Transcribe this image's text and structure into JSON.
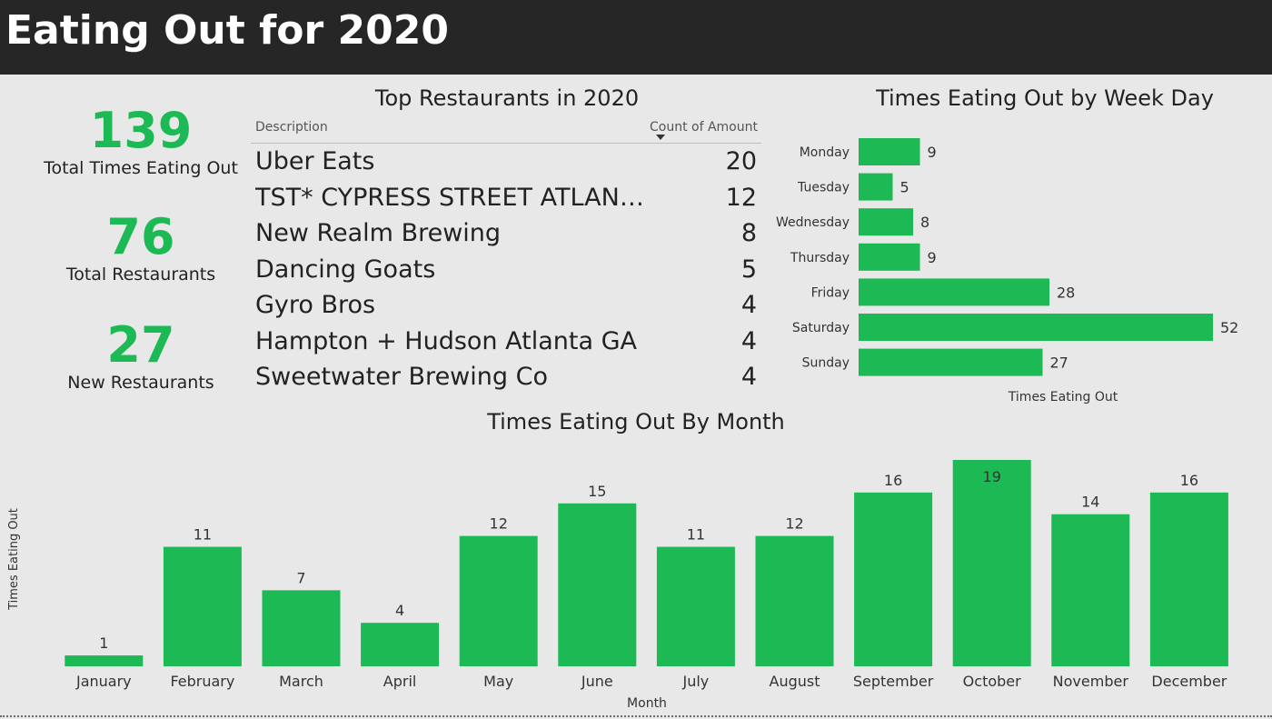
{
  "page": {
    "title": "Eating Out for 2020"
  },
  "kpis": [
    {
      "value": "139",
      "label": "Total Times Eating Out"
    },
    {
      "value": "76",
      "label": "Total Restaurants"
    },
    {
      "value": "27",
      "label": "New Restaurants"
    }
  ],
  "table": {
    "title": "Top Restaurants in 2020",
    "columns": [
      "Description",
      "Count of Amount"
    ],
    "sort_icon": "sort-descending-icon",
    "rows": [
      {
        "description": "Uber Eats",
        "count": "20"
      },
      {
        "description": "TST* CYPRESS STREET ATLANTA GA",
        "count": "12"
      },
      {
        "description": "New Realm Brewing",
        "count": "8"
      },
      {
        "description": "Dancing Goats",
        "count": "5"
      },
      {
        "description": "Gyro Bros",
        "count": "4"
      },
      {
        "description": "Hampton + Hudson Atlanta GA",
        "count": "4"
      },
      {
        "description": "Sweetwater Brewing Co",
        "count": "4"
      }
    ]
  },
  "colors": {
    "accent": "#1db954",
    "header_bg": "#262626",
    "background": "#e8e8e8"
  },
  "chart_data": [
    {
      "type": "bar",
      "orientation": "horizontal",
      "title": "Times Eating Out by Week Day",
      "categories": [
        "Monday",
        "Tuesday",
        "Wednesday",
        "Thursday",
        "Friday",
        "Saturday",
        "Sunday"
      ],
      "values": [
        9,
        5,
        8,
        9,
        28,
        52,
        27
      ],
      "xlabel": "Times Eating Out",
      "ylabel": "",
      "xlim": [
        0,
        52
      ],
      "data_labels": true,
      "grid": false
    },
    {
      "type": "bar",
      "orientation": "vertical",
      "title": "Times Eating Out By Month",
      "categories": [
        "January",
        "February",
        "March",
        "April",
        "May",
        "June",
        "July",
        "August",
        "September",
        "October",
        "November",
        "December"
      ],
      "values": [
        1,
        11,
        7,
        4,
        12,
        15,
        11,
        12,
        16,
        19,
        14,
        16
      ],
      "xlabel": "Month",
      "ylabel": "Times Eating Out",
      "ylim": [
        0,
        19
      ],
      "data_labels": true,
      "grid": false
    }
  ]
}
